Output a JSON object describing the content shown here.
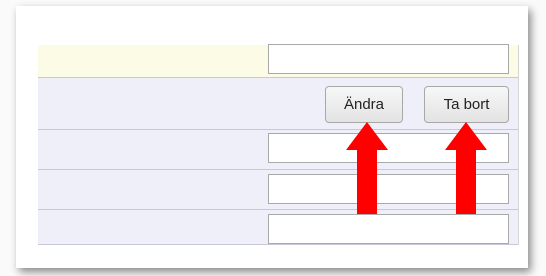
{
  "actions": {
    "edit_label": "Ändra",
    "delete_label": "Ta bort"
  },
  "colors": {
    "highlight_row": "#fbfbe6",
    "form_row": "#efeffa",
    "annotation_arrow": "#ff0000"
  }
}
